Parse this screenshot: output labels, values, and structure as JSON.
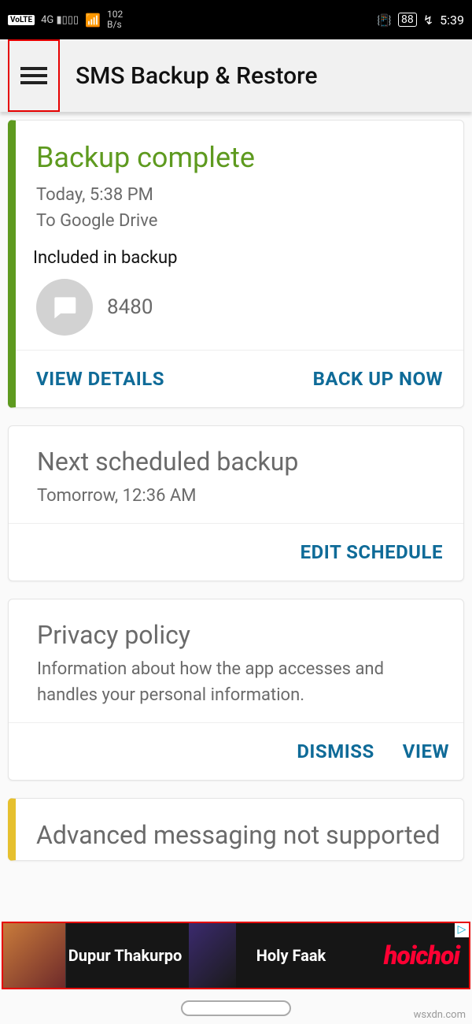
{
  "statusbar": {
    "volte": "VoLTE",
    "net_superscript": "4G",
    "speed_top": "102",
    "speed_bottom": "B/s",
    "battery": "88",
    "clock": "5:39"
  },
  "appbar": {
    "title": "SMS Backup & Restore"
  },
  "backup": {
    "heading": "Backup complete",
    "time": "Today, 5:38 PM",
    "destination": "To Google Drive",
    "included_label": "Included in backup",
    "count": "8480",
    "view_details": "VIEW DETAILS",
    "backup_now": "BACK UP NOW"
  },
  "schedule": {
    "heading": "Next scheduled backup",
    "time": "Tomorrow, 12:36 AM",
    "edit": "EDIT SCHEDULE"
  },
  "privacy": {
    "heading": "Privacy policy",
    "body": "Information about how the app accesses and handles your personal information.",
    "dismiss": "DISMISS",
    "view": "VIEW"
  },
  "advanced": {
    "heading": "Advanced messaging not supported"
  },
  "ad": {
    "title1": "Dupur Thakurpo",
    "title2": "Holy Faak",
    "brand": "hoichoi"
  },
  "watermark": "wsxdn.com"
}
